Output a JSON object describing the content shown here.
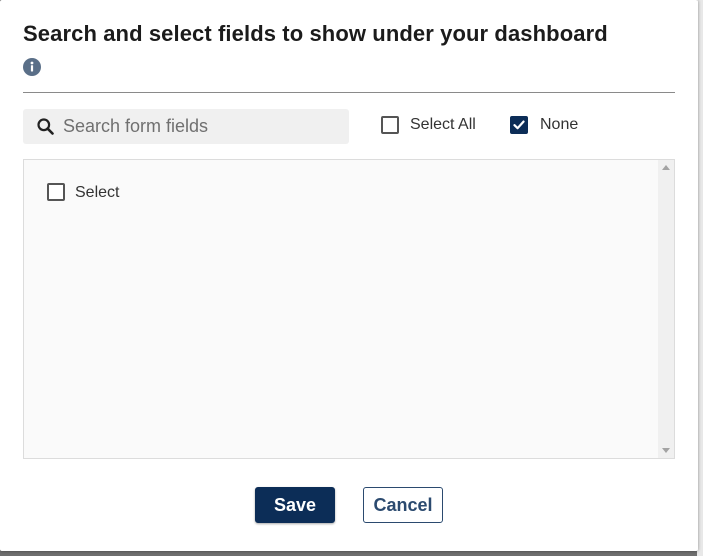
{
  "dialog": {
    "title": "Search and select fields to show under your dashboard"
  },
  "search": {
    "placeholder": "Search form fields",
    "value": ""
  },
  "selection_options": {
    "select_all_label": "Select All",
    "select_all_checked": false,
    "none_label": "None",
    "none_checked": true
  },
  "field_list": {
    "items": [
      {
        "label": "Select",
        "checked": false
      }
    ]
  },
  "buttons": {
    "save_label": "Save",
    "cancel_label": "Cancel"
  },
  "colors": {
    "primary": "#0c2d57",
    "info_icon": "#5a6f88"
  },
  "icons": {
    "info": "info-circle-icon",
    "search": "search-icon",
    "checkmark": "checkmark-icon"
  }
}
